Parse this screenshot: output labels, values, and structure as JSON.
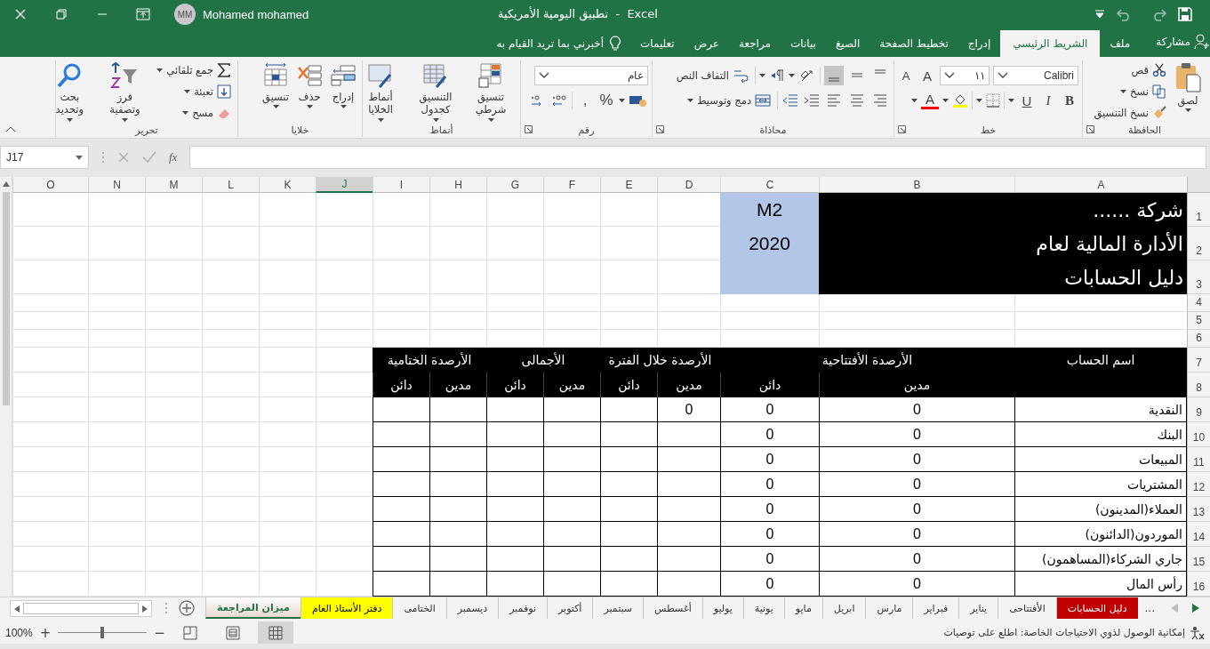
{
  "title_bar": {
    "title": "تطبيق اليومية الأمريكية  -  Excel",
    "user_name": "Mohamed mohamed",
    "user_initials": "MM"
  },
  "ribbon_tabs": [
    {
      "label": "ملف",
      "selected": false
    },
    {
      "label": "الشريط الرئيسي",
      "selected": true
    },
    {
      "label": "إدراج",
      "selected": false
    },
    {
      "label": "تخطيط الصفحة",
      "selected": false
    },
    {
      "label": "الصيغ",
      "selected": false
    },
    {
      "label": "بيانات",
      "selected": false
    },
    {
      "label": "مراجعة",
      "selected": false
    },
    {
      "label": "عرض",
      "selected": false
    },
    {
      "label": "تعليمات",
      "selected": false
    }
  ],
  "tell_me": "أخبرني بما تريد القيام به",
  "share": "مشاركة",
  "ribbon": {
    "clipboard": {
      "title": "الحافظة",
      "paste": "لصق",
      "cut": "قص",
      "copy": "نسخ",
      "format_painter": "نسخ التنسيق"
    },
    "font": {
      "title": "خط",
      "font_name": "Calibri",
      "font_size": "١١",
      "grow": "A",
      "shrink": "A",
      "bold": "B",
      "italic": "I",
      "underline": "U",
      "font_color": "A"
    },
    "alignment": {
      "title": "محاذاة",
      "vertical": [
        {
          "selected": false
        },
        {
          "selected": false
        },
        {
          "selected": true
        }
      ],
      "wrap_text": "التفاف النص",
      "merge_center": "دمج وتوسيط"
    },
    "number": {
      "title": "رقم",
      "format": "عام",
      "percent": "%",
      "comma": ","
    },
    "styles": {
      "title": "أنماط",
      "conditional": "تنسيق شرطي",
      "as_table": "التنسيق كجدول",
      "cell_styles": "أنماط الخلايا"
    },
    "cells": {
      "title": "خلايا",
      "insert": "إدراج",
      "delete": "حذف",
      "format": "تنسيق"
    },
    "editing": {
      "title": "تحرير",
      "autosum": "جمع تلقائي",
      "fill": "تعبئة",
      "clear": "مسح",
      "sort_filter": "فرز وتصفية",
      "find_select": "بحث وتحديد"
    }
  },
  "formula_bar": {
    "name_box": "J17",
    "function_label": "fx"
  },
  "sheet": {
    "columns": [
      {
        "label": "A",
        "selected": false
      },
      {
        "label": "B",
        "selected": false
      },
      {
        "label": "C",
        "selected": false
      },
      {
        "label": "D",
        "selected": false
      },
      {
        "label": "E",
        "selected": false
      },
      {
        "label": "F",
        "selected": false
      },
      {
        "label": "G",
        "selected": false
      },
      {
        "label": "H",
        "selected": false
      },
      {
        "label": "I",
        "selected": false
      },
      {
        "label": "J",
        "selected": true
      },
      {
        "label": "K",
        "selected": false
      },
      {
        "label": "L",
        "selected": false
      },
      {
        "label": "M",
        "selected": false
      },
      {
        "label": "N",
        "selected": false
      },
      {
        "label": "O",
        "selected": false
      }
    ],
    "rows": [
      "1",
      "2",
      "3",
      "4",
      "5",
      "6",
      "7",
      "8",
      "9",
      "10",
      "11",
      "12",
      "13",
      "14",
      "15",
      "16"
    ],
    "title_lines": [
      "شركة ......",
      "الأدارة المالية لعام",
      "دليل الحسابات"
    ],
    "code_lines": [
      "M2",
      "2020"
    ],
    "table": {
      "groups": [
        "اسم الحساب",
        "الأرصدة الأفتتاحية",
        "الأرصدة خلال الفترة",
        "الأجمالى",
        "الأرصدة الختامية"
      ],
      "sub_headers": [
        "مدين",
        "دائن",
        "مدين",
        "دائن",
        "مدين",
        "دائن",
        "مدين",
        "دائن"
      ],
      "rows": [
        {
          "account": "النقدية",
          "values": [
            "0",
            "0",
            "0"
          ]
        },
        {
          "account": "البنك",
          "values": [
            "0",
            "0"
          ]
        },
        {
          "account": "المبيعات",
          "values": [
            "0",
            "0"
          ]
        },
        {
          "account": "المشتريات",
          "values": [
            "0",
            "0"
          ]
        },
        {
          "account": "العملاء(المدينون)",
          "values": [
            "0",
            "0"
          ]
        },
        {
          "account": "الموردون(الدائنون)",
          "values": [
            "0",
            "0"
          ]
        },
        {
          "account": "جاري الشركاء(المساهمون)",
          "values": [
            "0",
            "0"
          ]
        },
        {
          "account": "رأس المال",
          "values": [
            "0",
            "0"
          ]
        }
      ]
    }
  },
  "more_tabs": "...",
  "sheet_tabs": [
    {
      "label": "دليل الحسابات",
      "selected": false,
      "color": "#c00000"
    },
    {
      "label": "الأفتتاحى",
      "selected": false
    },
    {
      "label": "يناير",
      "selected": false
    },
    {
      "label": "فبراير",
      "selected": false
    },
    {
      "label": "مارس",
      "selected": false
    },
    {
      "label": "ابريل",
      "selected": false
    },
    {
      "label": "مايو",
      "selected": false
    },
    {
      "label": "يونية",
      "selected": false
    },
    {
      "label": "يوليو",
      "selected": false
    },
    {
      "label": "أغسطس",
      "selected": false
    },
    {
      "label": "سبتمبر",
      "selected": false
    },
    {
      "label": "أكتوبر",
      "selected": false
    },
    {
      "label": "نوفمبر",
      "selected": false
    },
    {
      "label": "ديسمبر",
      "selected": false
    },
    {
      "label": "الختامى",
      "selected": false
    },
    {
      "label": "دفتر الأستاذ العام",
      "selected": false,
      "color": "#ffff00"
    },
    {
      "label": "ميزان المراجعة",
      "selected": true
    }
  ],
  "status_bar": {
    "message": "إمكانية الوصول لذوي الاحتياجات الخاصة: اطلع على توصيات",
    "zoom": "100%",
    "zoom_in": "+",
    "zoom_out": "−",
    "zoom_slider": {
      "level": 0.5
    },
    "views": [
      {
        "selected": false
      },
      {
        "selected": false
      },
      {
        "selected": true
      }
    ]
  }
}
